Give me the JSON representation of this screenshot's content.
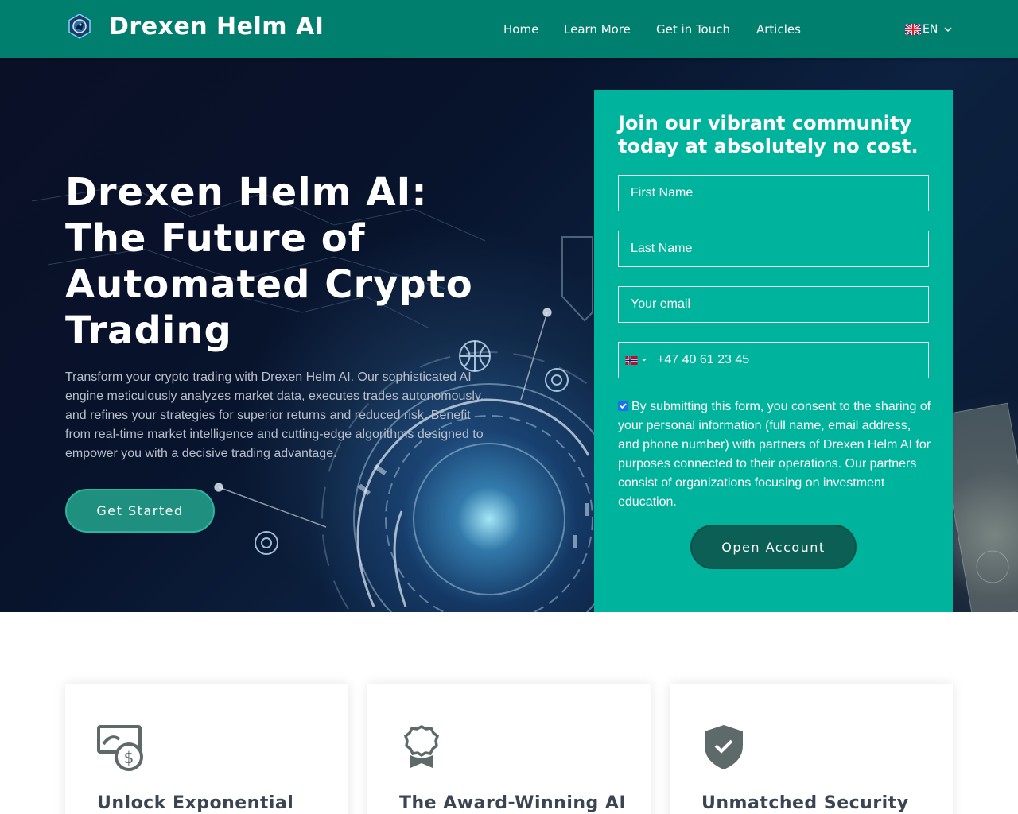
{
  "header": {
    "brand": "Drexen Helm AI",
    "nav": [
      {
        "label": "Home"
      },
      {
        "label": "Learn More"
      },
      {
        "label": "Get in Touch"
      },
      {
        "label": "Articles"
      }
    ],
    "language": "EN"
  },
  "hero": {
    "title_lines": [
      "Drexen Helm AI:",
      "The Future of",
      "Automated Crypto",
      "Trading"
    ],
    "description": "Transform your crypto trading with Drexen Helm AI. Our sophisticated AI engine meticulously analyzes market data, executes trades autonomously, and refines your strategies for superior returns and reduced risk. Benefit from real-time market intelligence and cutting-edge algorithms designed to empower you with a decisive trading advantage.",
    "cta_label": "Get Started"
  },
  "form": {
    "title": "Join our vibrant community today at absolutely no cost.",
    "first_name_placeholder": "First Name",
    "last_name_placeholder": "Last Name",
    "email_placeholder": "Your email",
    "phone_placeholder": "+47 40 61 23 45",
    "consent_checked": true,
    "consent_text": "By submitting this form, you consent to the sharing of your personal information (full name, email address, and phone number) with partners of Drexen Helm AI for purposes connected to their operations. Our partners consist of organizations focusing on investment education.",
    "submit_label": "Open Account"
  },
  "features": [
    {
      "icon": "money-icon",
      "title": "Unlock Exponential"
    },
    {
      "icon": "award-icon",
      "title": "The Award-Winning AI"
    },
    {
      "icon": "shield-check-icon",
      "title": "Unmatched Security"
    }
  ],
  "colors": {
    "header_bg": "#007e6e",
    "form_bg": "#00b39c",
    "primary_button": "#0b5f54",
    "hero_button": "#1f8f80",
    "card_title": "#3b4452"
  }
}
